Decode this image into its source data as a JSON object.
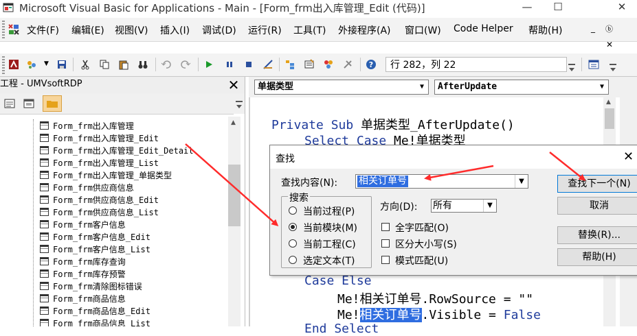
{
  "window": {
    "title": "Microsoft Visual Basic for Applications - Main - [Form_frm出入库管理_Edit (代码)]",
    "minimize": "—",
    "maximize": "☐",
    "close": "✕",
    "mdi_min": "_",
    "mdi_restore": "ⓑ",
    "mdi_close": "✕"
  },
  "menu": {
    "items": [
      "文件(F)",
      "编辑(E)",
      "视图(V)",
      "插入(I)",
      "调试(D)",
      "运行(R)",
      "工具(T)",
      "外接程序(A)",
      "窗口(W)",
      "Code Helper",
      "帮助(H)"
    ]
  },
  "toolbar": {
    "position": "行 282，列 22"
  },
  "project": {
    "title": "工程 - UMVsoftRDP",
    "close": "✕",
    "items": [
      "Form_frm出入库管理",
      "Form_frm出入库管理_Edit",
      "Form_frm出入库管理_Edit_Detail",
      "Form_frm出入库管理_List",
      "Form_frm出入库管理_单据类型",
      "Form_frm供应商信息",
      "Form_frm供应商信息_Edit",
      "Form_frm供应商信息_List",
      "Form_frm客户信息",
      "Form_frm客户信息_Edit",
      "Form_frm客户信息_List",
      "Form_frm库存查询",
      "Form_frm库存预警",
      "Form_frm清除图标错误",
      "Form_frm商品信息",
      "Form_frm商品信息_Edit",
      "Form_frm商品信息_List"
    ]
  },
  "code": {
    "object_combo": "单据类型",
    "proc_combo": "AfterUpdate",
    "line1_kw": "Private Sub",
    "line1_rest": " 单据类型_AfterUpdate()",
    "line2_kw1": "Select Case",
    "line2_rest": " Me!单据类型",
    "line3_kw": "Case Else",
    "line4": "Me!相关订单号.RowSource = \"\"",
    "line5_pre": "Me!",
    "line5_hl": "相关订单号",
    "line5_post": ".Visible = ",
    "line5_kw": "False",
    "line6_kw": "End Select"
  },
  "find": {
    "title": "查找",
    "close": "✕",
    "content_label": "查找内容(N):",
    "content_value": "相关订单号",
    "search_label": "搜索",
    "radios": [
      "当前过程(P)",
      "当前模块(M)",
      "当前工程(C)",
      "选定文本(T)"
    ],
    "selected_radio": "当前模块(M)",
    "direction_label": "方向(D):",
    "direction_value": "所有",
    "checks": [
      "全字匹配(O)",
      "区分大小写(S)",
      "模式匹配(U)"
    ],
    "buttons": {
      "find_next": "查找下一个(N)",
      "cancel": "取消",
      "replace": "替换(R)...",
      "help": "帮助(H)"
    }
  },
  "colors": {
    "keyword": "#1f3b9b",
    "selection": "#2f6de0",
    "annotation_arrow": "#ff2b2b"
  }
}
